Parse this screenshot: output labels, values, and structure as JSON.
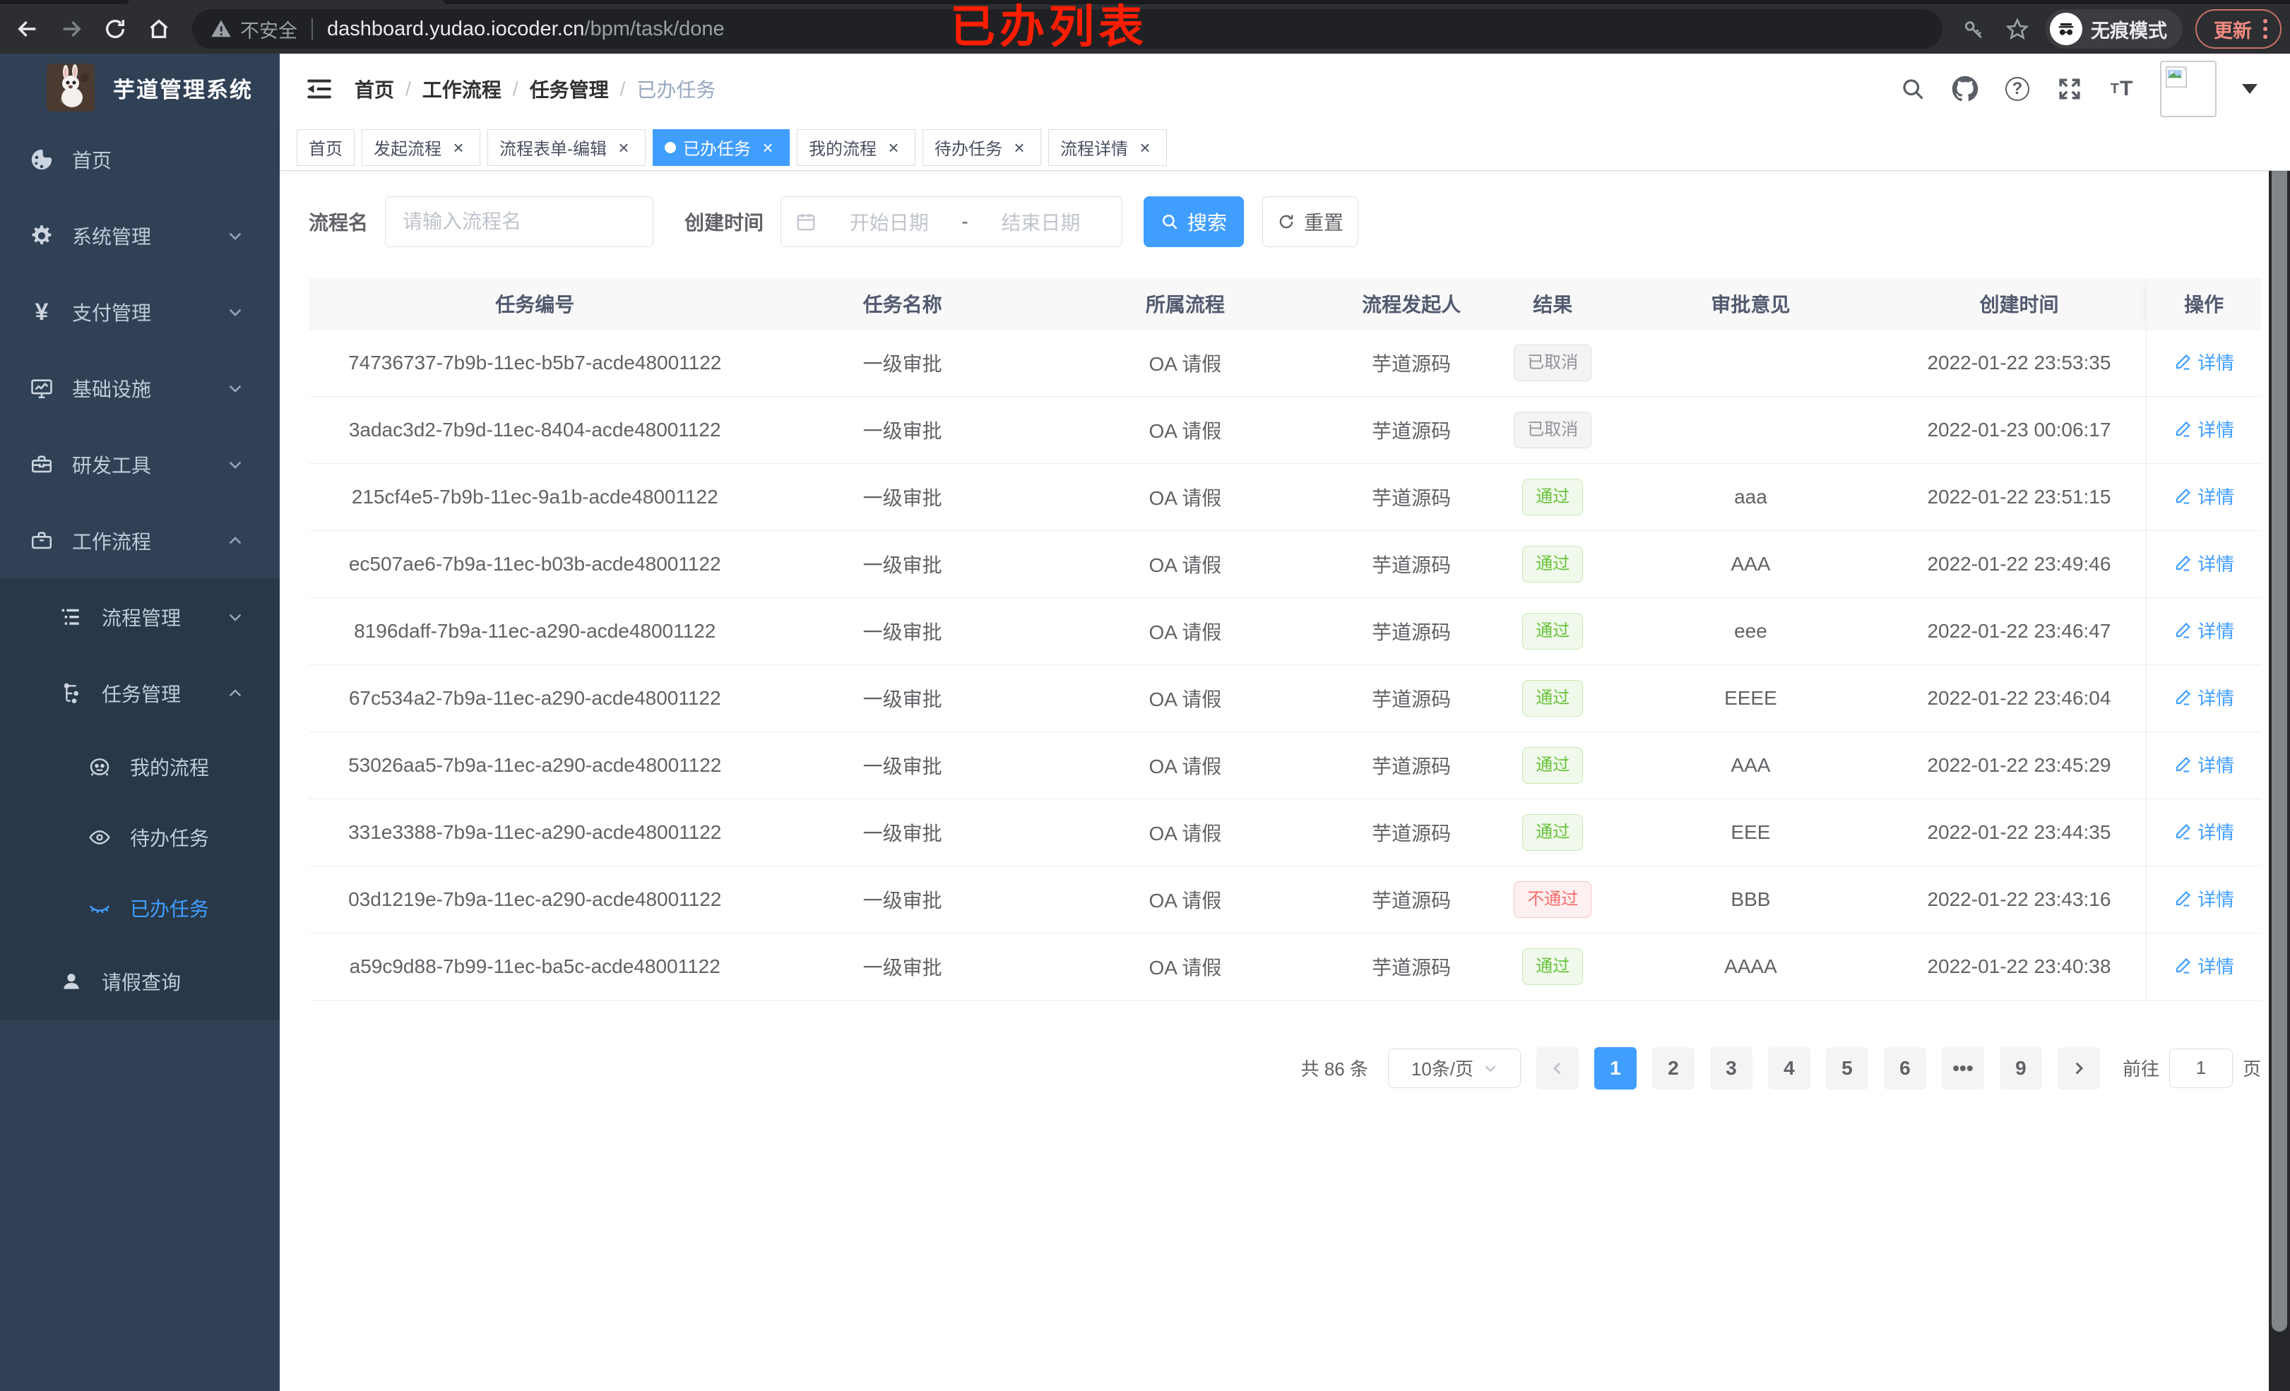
{
  "colors": {
    "primary": "#409EFF",
    "success": "#67C23A",
    "danger": "#F56C6C",
    "info": "#909399",
    "sidebar_bg": "#304156",
    "submenu_bg": "#283848",
    "annotation_red": "#FF1E00"
  },
  "browser": {
    "insecure_label": "不安全",
    "url_host": "dashboard.yudao.iocoder.cn",
    "url_path": "/bpm/task/done",
    "incognito_label": "无痕模式",
    "update_label": "更新",
    "annotation": "已办列表"
  },
  "sidebar": {
    "title": "芋道管理系统",
    "items": [
      {
        "label": "首页"
      },
      {
        "label": "系统管理"
      },
      {
        "label": "支付管理"
      },
      {
        "label": "基础设施"
      },
      {
        "label": "研发工具"
      },
      {
        "label": "工作流程"
      }
    ],
    "workflow_children": [
      {
        "label": "流程管理"
      },
      {
        "label": "任务管理"
      },
      {
        "label": "我的流程"
      },
      {
        "label": "待办任务"
      },
      {
        "label": "已办任务"
      },
      {
        "label": "请假查询"
      }
    ]
  },
  "navbar": {
    "breadcrumb": [
      "首页",
      "工作流程",
      "任务管理",
      "已办任务"
    ]
  },
  "tags": [
    {
      "label": "首页"
    },
    {
      "label": "发起流程"
    },
    {
      "label": "流程表单-编辑"
    },
    {
      "label": "已办任务"
    },
    {
      "label": "我的流程"
    },
    {
      "label": "待办任务"
    },
    {
      "label": "流程详情"
    }
  ],
  "filters": {
    "name_label": "流程名",
    "name_placeholder": "请输入流程名",
    "time_label": "创建时间",
    "start_placeholder": "开始日期",
    "range_separator": "-",
    "end_placeholder": "结束日期",
    "search_label": "搜索",
    "reset_label": "重置"
  },
  "table": {
    "columns": [
      "任务编号",
      "任务名称",
      "所属流程",
      "流程发起人",
      "结果",
      "审批意见",
      "创建时间",
      "操作"
    ],
    "action_label": "详情",
    "rows": [
      {
        "id": "74736737-7b9b-11ec-b5b7-acde48001122",
        "name": "一级审批",
        "flow": "OA 请假",
        "starter": "芋道源码",
        "result": "已取消",
        "result_type": "info",
        "comment": "",
        "created": "2022-01-22 23:53:35"
      },
      {
        "id": "3adac3d2-7b9d-11ec-8404-acde48001122",
        "name": "一级审批",
        "flow": "OA 请假",
        "starter": "芋道源码",
        "result": "已取消",
        "result_type": "info",
        "comment": "",
        "created": "2022-01-23 00:06:17"
      },
      {
        "id": "215cf4e5-7b9b-11ec-9a1b-acde48001122",
        "name": "一级审批",
        "flow": "OA 请假",
        "starter": "芋道源码",
        "result": "通过",
        "result_type": "success",
        "comment": "aaa",
        "created": "2022-01-22 23:51:15"
      },
      {
        "id": "ec507ae6-7b9a-11ec-b03b-acde48001122",
        "name": "一级审批",
        "flow": "OA 请假",
        "starter": "芋道源码",
        "result": "通过",
        "result_type": "success",
        "comment": "AAA",
        "created": "2022-01-22 23:49:46"
      },
      {
        "id": "8196daff-7b9a-11ec-a290-acde48001122",
        "name": "一级审批",
        "flow": "OA 请假",
        "starter": "芋道源码",
        "result": "通过",
        "result_type": "success",
        "comment": "eee",
        "created": "2022-01-22 23:46:47"
      },
      {
        "id": "67c534a2-7b9a-11ec-a290-acde48001122",
        "name": "一级审批",
        "flow": "OA 请假",
        "starter": "芋道源码",
        "result": "通过",
        "result_type": "success",
        "comment": "EEEE",
        "created": "2022-01-22 23:46:04"
      },
      {
        "id": "53026aa5-7b9a-11ec-a290-acde48001122",
        "name": "一级审批",
        "flow": "OA 请假",
        "starter": "芋道源码",
        "result": "通过",
        "result_type": "success",
        "comment": "AAA",
        "created": "2022-01-22 23:45:29"
      },
      {
        "id": "331e3388-7b9a-11ec-a290-acde48001122",
        "name": "一级审批",
        "flow": "OA 请假",
        "starter": "芋道源码",
        "result": "通过",
        "result_type": "success",
        "comment": "EEE",
        "created": "2022-01-22 23:44:35"
      },
      {
        "id": "03d1219e-7b9a-11ec-a290-acde48001122",
        "name": "一级审批",
        "flow": "OA 请假",
        "starter": "芋道源码",
        "result": "不通过",
        "result_type": "danger",
        "comment": "BBB",
        "created": "2022-01-22 23:43:16"
      },
      {
        "id": "a59c9d88-7b99-11ec-ba5c-acde48001122",
        "name": "一级审批",
        "flow": "OA 请假",
        "starter": "芋道源码",
        "result": "通过",
        "result_type": "success",
        "comment": "AAAA",
        "created": "2022-01-22 23:40:38"
      }
    ]
  },
  "pagination": {
    "total_label": "共 86 条",
    "page_size": "10条/页",
    "pages": [
      "1",
      "2",
      "3",
      "4",
      "5",
      "6",
      "9"
    ],
    "more": "•••",
    "goto_label": "前往",
    "goto_value": "1",
    "goto_suffix": "页"
  }
}
